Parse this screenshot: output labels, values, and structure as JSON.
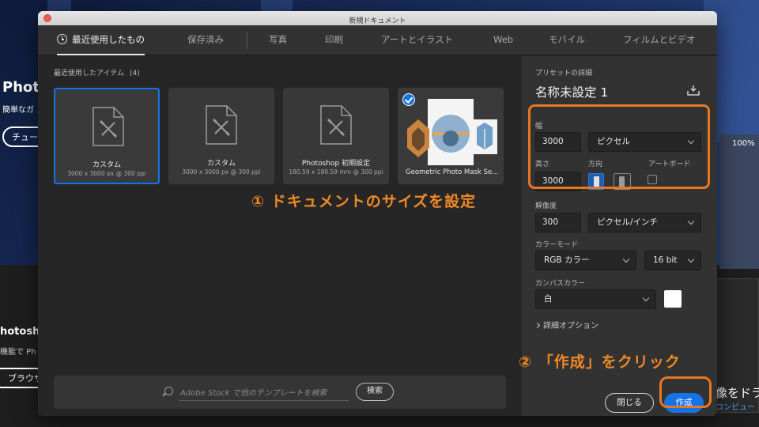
{
  "background": {
    "app_name": "Photo",
    "tagline": "簡単なガ",
    "pill_button": "チュー",
    "section_title": "hotosho",
    "section_sub": "機能で Ph",
    "browser_button": "ブラウザ",
    "zoom": "100%",
    "right_caption": "像をドラ",
    "right_sub": "コンピュー"
  },
  "dialog": {
    "title": "新規ドキュメント",
    "tabs": [
      {
        "label": "最近使用したもの",
        "active": true
      },
      {
        "label": "保存済み"
      },
      {
        "label": "写真"
      },
      {
        "label": "印刷"
      },
      {
        "label": "アートとイラスト"
      },
      {
        "label": "Web"
      },
      {
        "label": "モバイル"
      },
      {
        "label": "フィルムとビデオ"
      }
    ],
    "recent": {
      "heading": "最近使用したアイテム",
      "count": "(4)",
      "items": [
        {
          "name": "カスタム",
          "dims": "3000 x 3000 px @ 300 ppi"
        },
        {
          "name": "カスタム",
          "dims": "3000 x 3000 px @ 300 ppi"
        },
        {
          "name": "Photoshop 初期設定",
          "dims": "180.59 x 180.59 mm @ 300 ppi"
        },
        {
          "name": "Geometric Photo Mask Se..."
        }
      ]
    },
    "search": {
      "placeholder": "Adobe Stock で他のテンプレートを検索",
      "button": "検索"
    },
    "preset": {
      "heading": "プリセットの詳細",
      "name": "名称未設定 1",
      "width_label": "幅",
      "width_value": "3000",
      "unit": "ピクセル",
      "height_label": "高さ",
      "height_value": "3000",
      "orientation_label": "方向",
      "artboard_label": "アートボード",
      "resolution_label": "解像度",
      "resolution_value": "300",
      "resolution_unit": "ピクセル/インチ",
      "color_mode_label": "カラーモード",
      "color_mode": "RGB カラー",
      "bit_depth": "16 bit",
      "canvas_label": "カンバスカラー",
      "canvas_color": "白",
      "advanced": "詳細オプション"
    },
    "buttons": {
      "close": "閉じる",
      "create": "作成"
    }
  },
  "annotations": {
    "step1": "① ドキュメントのサイズを設定",
    "step2": "② 「作成」をクリック",
    "color": "#e87722"
  }
}
